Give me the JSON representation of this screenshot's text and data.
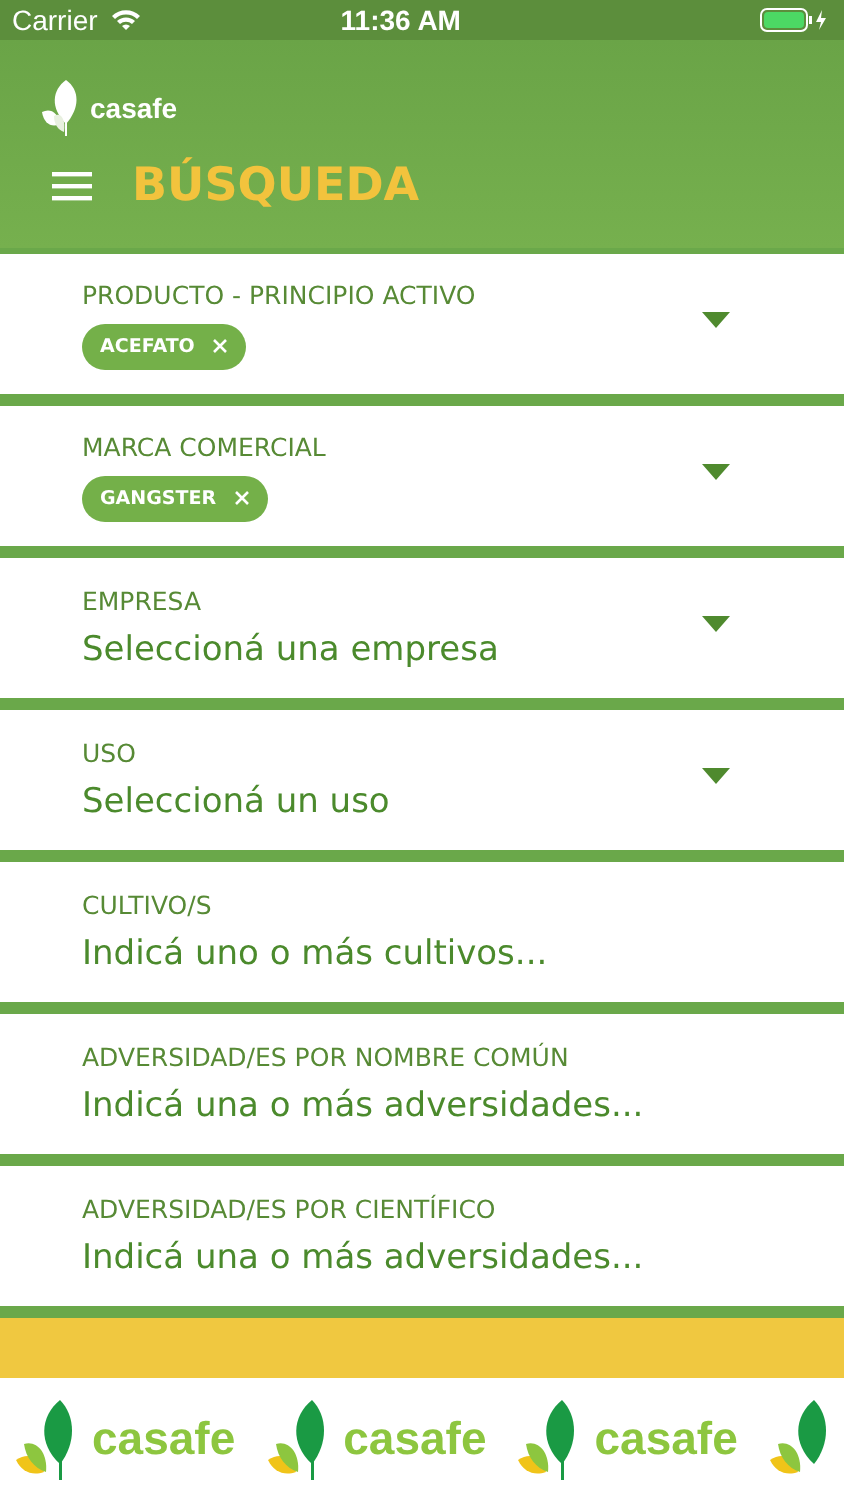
{
  "status_bar": {
    "carrier": "Carrier",
    "time": "11:36 AM"
  },
  "header": {
    "logo_text": "casafe",
    "title": "BÚSQUEDA"
  },
  "fields": [
    {
      "kind": "chips",
      "label": "PRODUCTO - PRINCIPIO ACTIVO",
      "chips": [
        "ACEFATO"
      ]
    },
    {
      "kind": "chips",
      "label": "MARCA COMERCIAL",
      "chips": [
        "GANGSTER"
      ]
    },
    {
      "kind": "select",
      "label": "EMPRESA",
      "value": "Seleccioná una empresa"
    },
    {
      "kind": "select",
      "label": "USO",
      "value": "Seleccioná un uso"
    },
    {
      "kind": "text",
      "label": "CULTIVO/S",
      "placeholder": "Indicá uno o más cultivos..."
    },
    {
      "kind": "text",
      "label": "ADVERSIDAD/ES POR NOMBRE COMÚN",
      "placeholder": "Indicá una o más adversidades..."
    },
    {
      "kind": "text",
      "label": "ADVERSIDAD/ES POR CIENTÍFICO",
      "placeholder": "Indicá una o más adversidades..."
    }
  ],
  "banner": {
    "logos": [
      "casafe",
      "casafe",
      "casafe"
    ]
  }
}
